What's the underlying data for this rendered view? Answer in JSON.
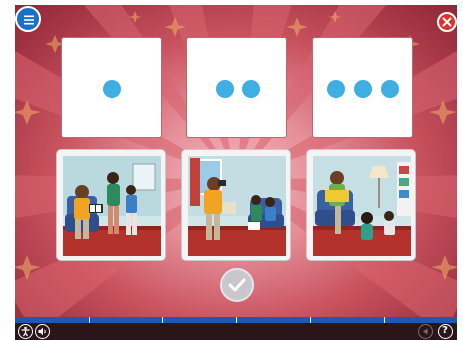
{
  "activity": {
    "dot_cards": [
      {
        "count": 1
      },
      {
        "count": 2
      },
      {
        "count": 3
      }
    ],
    "dot_color": "#3eaee3",
    "picture_cards": [
      {
        "icon": "family-photo-album-illustration"
      },
      {
        "icon": "grandfather-binoculars-illustration"
      },
      {
        "icon": "grandfather-reading-book-illustration"
      }
    ],
    "check_button_state": "disabled"
  },
  "toolbar": {
    "menu_icon": "menu-icon",
    "close_icon": "close-icon"
  },
  "footer": {
    "help_label": "?",
    "progress_segments": 6,
    "accent_color": "#1f57b5"
  }
}
